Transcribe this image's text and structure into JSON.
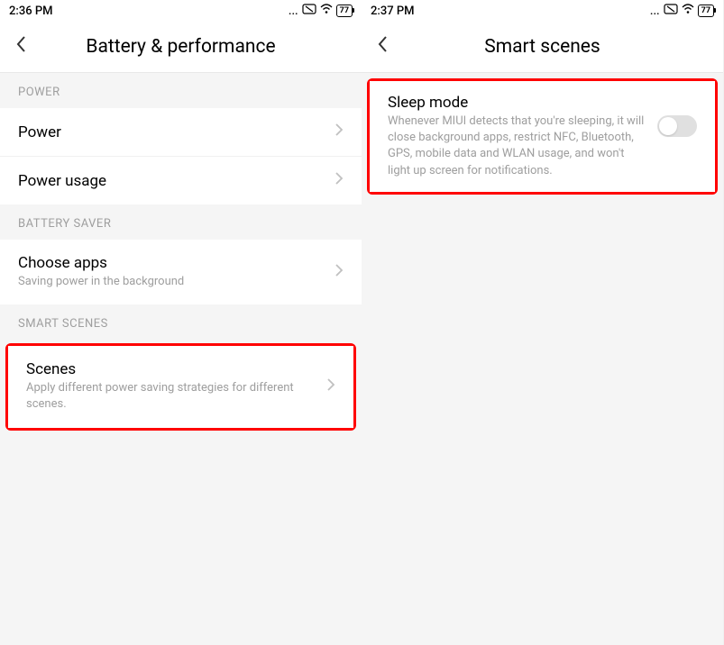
{
  "screen1": {
    "statusBar": {
      "time": "2:36 PM",
      "dots": "...",
      "battery": "77"
    },
    "header": {
      "title": "Battery & performance"
    },
    "sections": {
      "power": {
        "header": "POWER",
        "items": [
          {
            "title": "Power"
          },
          {
            "title": "Power usage"
          }
        ]
      },
      "batterySaver": {
        "header": "BATTERY SAVER",
        "items": [
          {
            "title": "Choose apps",
            "subtitle": "Saving power in the background"
          }
        ]
      },
      "smartScenes": {
        "header": "SMART SCENES",
        "items": [
          {
            "title": "Scenes",
            "subtitle": "Apply different power saving strategies for different scenes."
          }
        ]
      }
    }
  },
  "screen2": {
    "statusBar": {
      "time": "2:37 PM",
      "dots": "...",
      "battery": "77"
    },
    "header": {
      "title": "Smart scenes"
    },
    "items": {
      "sleepMode": {
        "title": "Sleep mode",
        "subtitle": "Whenever MIUI detects that you're sleeping, it will close background apps, restrict NFC, Bluetooth, GPS, mobile data and WLAN usage, and won't light up screen for notifications.",
        "toggled": false
      }
    }
  }
}
